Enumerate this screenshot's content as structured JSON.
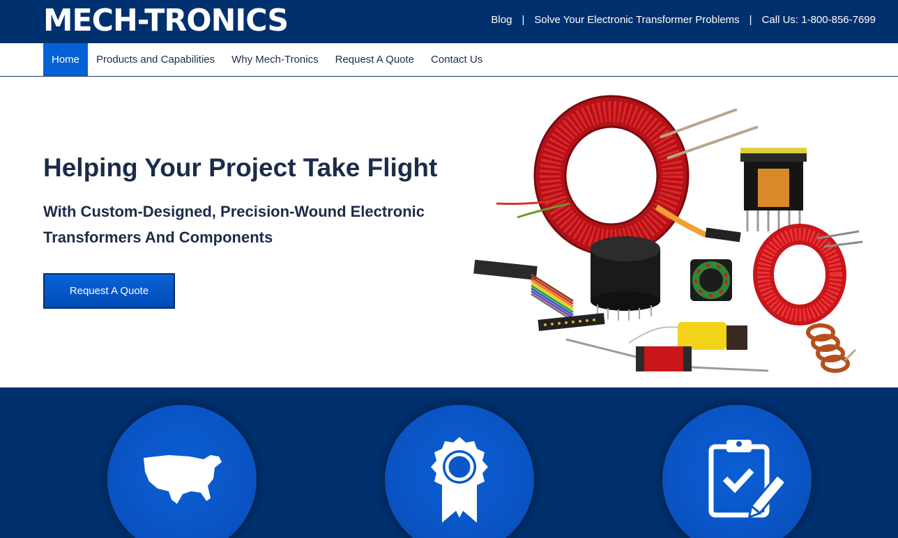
{
  "header": {
    "logo": "MECH-TRONICS",
    "links": [
      {
        "label": "Blog"
      },
      {
        "label": "Solve Your Electronic Transformer Problems"
      },
      {
        "label": "Call Us: 1-800-856-7699"
      }
    ],
    "separator": "|"
  },
  "nav": {
    "items": [
      {
        "label": "Home",
        "active": true
      },
      {
        "label": "Products and Capabilities",
        "active": false
      },
      {
        "label": "Why Mech-Tronics",
        "active": false
      },
      {
        "label": "Request A Quote",
        "active": false
      },
      {
        "label": "Contact Us",
        "active": false
      }
    ]
  },
  "hero": {
    "title": "Helping Your Project Take Flight",
    "subtitle": "With Custom-Designed, Precision-Wound Electronic Transformers And Components",
    "cta_label": "Request A Quote"
  },
  "features": {
    "icons": [
      "usa-map-icon",
      "award-ribbon-icon",
      "clipboard-check-icon"
    ]
  },
  "colors": {
    "brand_navy": "#00306e",
    "accent_blue": "#0660d6",
    "text_dark": "#1b2c4a",
    "copper_red": "#c8161b"
  }
}
